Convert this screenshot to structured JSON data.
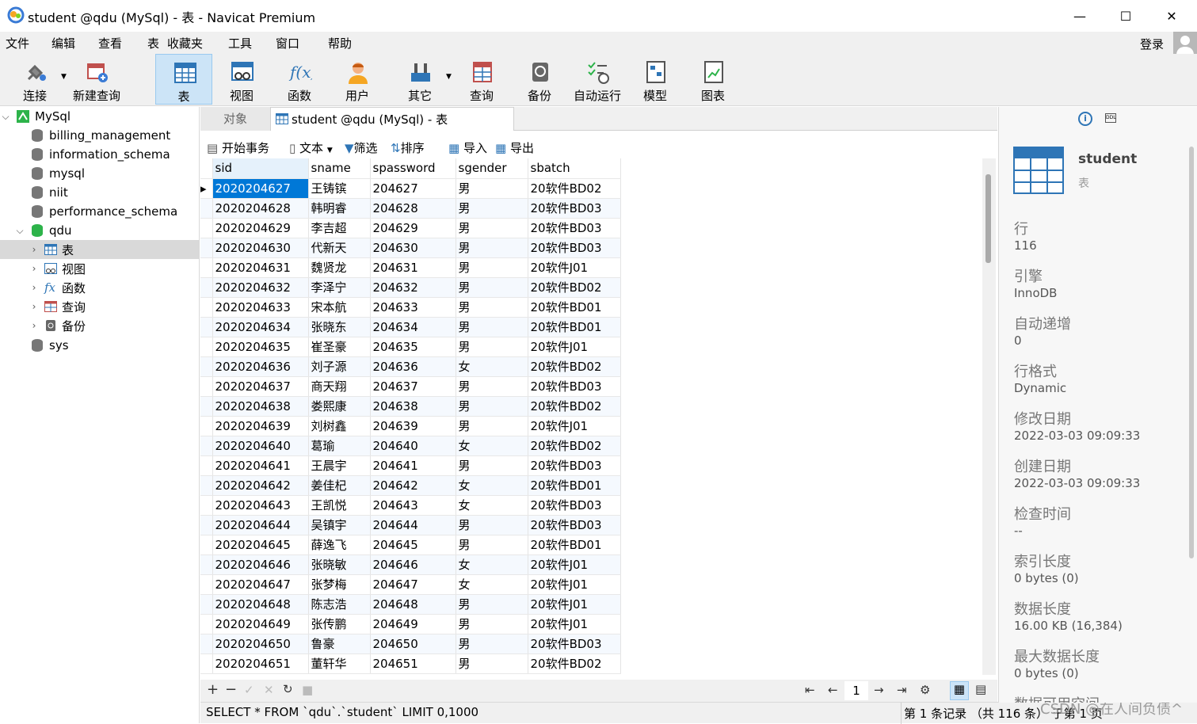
{
  "window": {
    "title": "student @qdu (MySql) - 表 - Navicat Premium",
    "minimize": "—",
    "maximize": "☐",
    "close": "✕"
  },
  "menu": [
    "文件",
    "编辑",
    "查看",
    "表",
    "收藏夹",
    "工具",
    "窗口",
    "帮助"
  ],
  "login": "登录",
  "toolbar": [
    {
      "label": "连接",
      "icon": "plug-icon"
    },
    {
      "label": "新建查询",
      "icon": "new-query-icon"
    },
    {
      "label": "表",
      "icon": "table-icon"
    },
    {
      "label": "视图",
      "icon": "view-icon"
    },
    {
      "label": "函数",
      "icon": "function-icon"
    },
    {
      "label": "用户",
      "icon": "user-icon"
    },
    {
      "label": "其它",
      "icon": "tools-icon"
    },
    {
      "label": "查询",
      "icon": "query-icon"
    },
    {
      "label": "备份",
      "icon": "backup-icon"
    },
    {
      "label": "自动运行",
      "icon": "auto-run-icon"
    },
    {
      "label": "模型",
      "icon": "model-icon"
    },
    {
      "label": "图表",
      "icon": "chart-icon"
    }
  ],
  "tree": {
    "connection": "MySql",
    "databases": [
      "billing_management",
      "information_schema",
      "mysql",
      "niit",
      "performance_schema"
    ],
    "open_db": "qdu",
    "children": [
      "表",
      "视图",
      "函数",
      "查询",
      "备份"
    ],
    "last_db": "sys"
  },
  "tabs": {
    "objects": "对象",
    "active": "student @qdu (MySql) - 表"
  },
  "subtoolbar": {
    "begin_tx": "开始事务",
    "text": "文本",
    "filter": "筛选",
    "sort": "排序",
    "import": "导入",
    "export": "导出"
  },
  "table": {
    "columns": [
      "sid",
      "sname",
      "spassword",
      "sgender",
      "sbatch"
    ],
    "rows": [
      [
        "2020204627",
        "王铸镔",
        "204627",
        "男",
        "20软件BD02"
      ],
      [
        "2020204628",
        "韩明睿",
        "204628",
        "男",
        "20软件BD03"
      ],
      [
        "2020204629",
        "李吉超",
        "204629",
        "男",
        "20软件BD03"
      ],
      [
        "2020204630",
        "代新天",
        "204630",
        "男",
        "20软件BD03"
      ],
      [
        "2020204631",
        "魏贤龙",
        "204631",
        "男",
        "20软件J01"
      ],
      [
        "2020204632",
        "李泽宁",
        "204632",
        "男",
        "20软件BD02"
      ],
      [
        "2020204633",
        "宋本航",
        "204633",
        "男",
        "20软件BD01"
      ],
      [
        "2020204634",
        "张晓东",
        "204634",
        "男",
        "20软件BD01"
      ],
      [
        "2020204635",
        "崔圣豪",
        "204635",
        "男",
        "20软件J01"
      ],
      [
        "2020204636",
        "刘子源",
        "204636",
        "女",
        "20软件BD02"
      ],
      [
        "2020204637",
        "商天翔",
        "204637",
        "男",
        "20软件BD03"
      ],
      [
        "2020204638",
        "娄熙康",
        "204638",
        "男",
        "20软件BD02"
      ],
      [
        "2020204639",
        "刘树鑫",
        "204639",
        "男",
        "20软件J01"
      ],
      [
        "2020204640",
        "葛瑜",
        "204640",
        "女",
        "20软件BD02"
      ],
      [
        "2020204641",
        "王晨宇",
        "204641",
        "男",
        "20软件BD03"
      ],
      [
        "2020204642",
        "姜佳杞",
        "204642",
        "女",
        "20软件BD01"
      ],
      [
        "2020204643",
        "王凯悦",
        "204643",
        "女",
        "20软件BD03"
      ],
      [
        "2020204644",
        "吴镇宇",
        "204644",
        "男",
        "20软件BD03"
      ],
      [
        "2020204645",
        "薛逸飞",
        "204645",
        "男",
        "20软件BD01"
      ],
      [
        "2020204646",
        "张晓敏",
        "204646",
        "女",
        "20软件J01"
      ],
      [
        "2020204647",
        "张梦梅",
        "204647",
        "女",
        "20软件J01"
      ],
      [
        "2020204648",
        "陈志浩",
        "204648",
        "男",
        "20软件J01"
      ],
      [
        "2020204649",
        "张传鹏",
        "204649",
        "男",
        "20软件J01"
      ],
      [
        "2020204650",
        "鲁豪",
        "204650",
        "男",
        "20软件BD03"
      ],
      [
        "2020204651",
        "董轩华",
        "204651",
        "男",
        "20软件BD02"
      ]
    ]
  },
  "pager": {
    "page": "1"
  },
  "status": {
    "sql": "SELECT * FROM `qdu`.`student` LIMIT 0,1000",
    "records": "第 1 条记录 （共 116 条） 于第 1 页"
  },
  "info": {
    "name": "student",
    "type": "表",
    "fields": [
      {
        "label": "行",
        "value": "116"
      },
      {
        "label": "引擎",
        "value": "InnoDB"
      },
      {
        "label": "自动递增",
        "value": "0"
      },
      {
        "label": "行格式",
        "value": "Dynamic"
      },
      {
        "label": "修改日期",
        "value": "2022-03-03 09:09:33"
      },
      {
        "label": "创建日期",
        "value": "2022-03-03 09:09:33"
      },
      {
        "label": "检查时间",
        "value": "--"
      },
      {
        "label": "索引长度",
        "value": "0 bytes (0)"
      },
      {
        "label": "数据长度",
        "value": "16.00 KB (16,384)"
      },
      {
        "label": "最大数据长度",
        "value": "0 bytes (0)"
      },
      {
        "label": "数据可用空间",
        "value": ""
      }
    ]
  },
  "watermark": "CSDN @在人间负债^",
  "colors": {
    "accent": "#0078d7",
    "selected_tab": "#cce4f7",
    "db_green": "#2db34a"
  }
}
